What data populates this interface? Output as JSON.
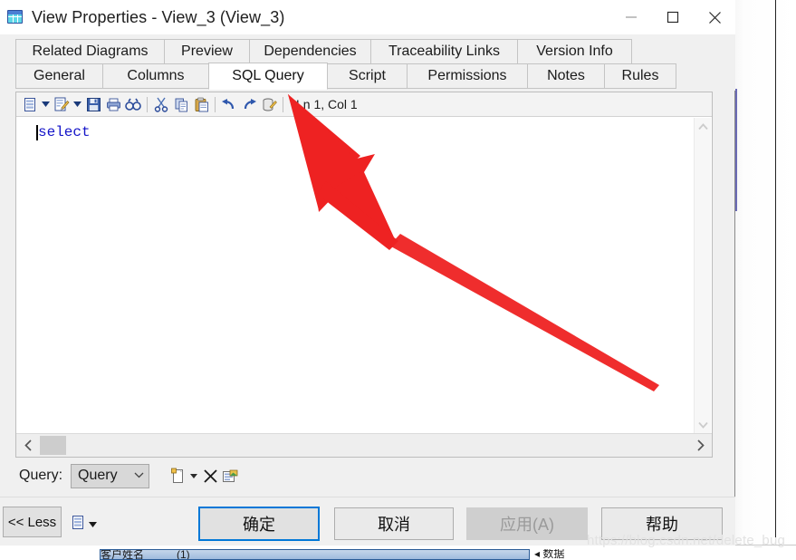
{
  "window": {
    "title": "View Properties - View_3 (View_3)",
    "icon": "view-table-icon",
    "minimize_label": "—",
    "maximize_label": "□",
    "close_label": "✕"
  },
  "tabs": {
    "row1": [
      {
        "label": "Related Diagrams",
        "active": false
      },
      {
        "label": "Preview",
        "active": false
      },
      {
        "label": "Dependencies",
        "active": false
      },
      {
        "label": "Traceability Links",
        "active": false
      },
      {
        "label": "Version Info",
        "active": false
      }
    ],
    "row2": [
      {
        "label": "General",
        "active": false
      },
      {
        "label": "Columns",
        "active": false
      },
      {
        "label": "SQL Query",
        "active": true
      },
      {
        "label": "Script",
        "active": false
      },
      {
        "label": "Permissions",
        "active": false
      },
      {
        "label": "Notes",
        "active": false
      },
      {
        "label": "Rules",
        "active": false
      }
    ]
  },
  "editor": {
    "toolbar": [
      {
        "name": "load-script-icon",
        "type": "icon"
      },
      {
        "name": "load-script-dropdown-icon",
        "type": "caret"
      },
      {
        "name": "edit-script-icon",
        "type": "icon"
      },
      {
        "name": "edit-script-dropdown-icon",
        "type": "caret"
      },
      {
        "name": "save-icon",
        "type": "icon"
      },
      {
        "name": "print-icon",
        "type": "icon"
      },
      {
        "name": "find-icon",
        "type": "icon"
      },
      {
        "name": "separator-1",
        "type": "sep"
      },
      {
        "name": "cut-icon",
        "type": "icon"
      },
      {
        "name": "copy-icon",
        "type": "icon"
      },
      {
        "name": "paste-icon",
        "type": "icon"
      },
      {
        "name": "separator-2",
        "type": "sep"
      },
      {
        "name": "undo-icon",
        "type": "icon"
      },
      {
        "name": "redo-icon",
        "type": "icon"
      },
      {
        "name": "database-icon",
        "type": "icon"
      },
      {
        "name": "separator-3",
        "type": "sep"
      }
    ],
    "status": "Ln 1, Col 1",
    "sql_text": "select",
    "keyword_color": "#1414c8"
  },
  "query_row": {
    "label": "Query:",
    "selected_value": "Query",
    "dropdown_chevron": "∨",
    "icons": [
      {
        "name": "new-query-icon"
      },
      {
        "name": "new-query-dropdown-icon"
      },
      {
        "name": "delete-query-icon"
      },
      {
        "name": "query-properties-icon"
      }
    ]
  },
  "buttons": {
    "less": "<< Less",
    "ok": "确定",
    "cancel": "取消",
    "apply": "应用(A)",
    "help": "帮助",
    "ok_focus_color": "#0078d7",
    "apply_disabled": true
  },
  "annotation": {
    "type": "red-arrow",
    "color": "#ee2222",
    "points_to": "SQL Query tab"
  },
  "watermark": "https://blog.csdn.net/delete_bug",
  "background": {
    "bottom_row_text": "客户姓名　　　(1)",
    "bottom_row2_text": "◂ 数据"
  }
}
